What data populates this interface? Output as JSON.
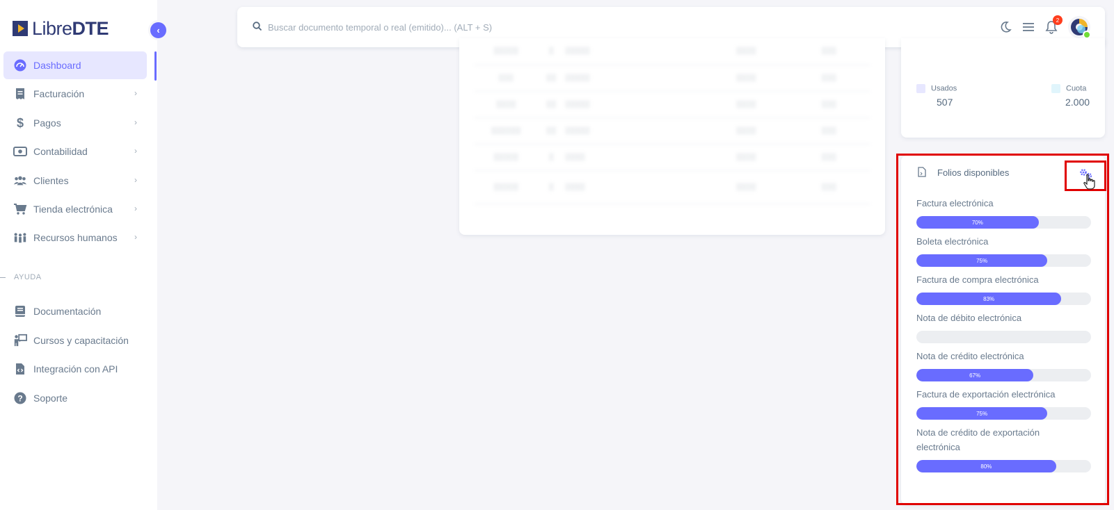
{
  "brand": {
    "prefix": "Libre",
    "suffix": "DTE"
  },
  "sidebar": {
    "items": [
      {
        "label": "Dashboard",
        "icon": "dashboard-icon",
        "active": true,
        "has_children": false
      },
      {
        "label": "Facturación",
        "icon": "invoice-icon",
        "has_children": true
      },
      {
        "label": "Pagos",
        "icon": "dollar-icon",
        "has_children": true
      },
      {
        "label": "Contabilidad",
        "icon": "money-icon",
        "has_children": true
      },
      {
        "label": "Clientes",
        "icon": "users-icon",
        "has_children": true
      },
      {
        "label": "Tienda electrónica",
        "icon": "cart-icon",
        "has_children": true
      },
      {
        "label": "Recursos humanos",
        "icon": "people-icon",
        "has_children": true
      }
    ],
    "help_header": "AYUDA",
    "help_items": [
      {
        "label": "Documentación",
        "icon": "book-icon"
      },
      {
        "label": "Cursos y capacitación",
        "icon": "teacher-icon"
      },
      {
        "label": "Integración con API",
        "icon": "code-file-icon"
      },
      {
        "label": "Soporte",
        "icon": "question-icon"
      }
    ]
  },
  "search": {
    "placeholder": "Buscar documento temporal o real (emitido)... (ALT + S)"
  },
  "topbar": {
    "notification_count": "2"
  },
  "usage": {
    "used_label": "Usados",
    "used_value": "507",
    "quota_label": "Cuota",
    "quota_value": "2.000",
    "used_color": "#e7e7ff",
    "quota_color": "#e0f5fc"
  },
  "folios": {
    "title": "Folios disponibles",
    "items": [
      {
        "label": "Factura electrónica",
        "percent": 70,
        "percent_label": "70%"
      },
      {
        "label": "Boleta electrónica",
        "percent": 75,
        "percent_label": "75%"
      },
      {
        "label": "Factura de compra electrónica",
        "percent": 83,
        "percent_label": "83%"
      },
      {
        "label": "Nota de débito electrónica",
        "percent": 0,
        "percent_label": ""
      },
      {
        "label": "Nota de crédito electrónica",
        "percent": 67,
        "percent_label": "67%"
      },
      {
        "label": "Factura de exportación electrónica",
        "percent": 75,
        "percent_label": "75%"
      },
      {
        "label": "Nota de crédito de exportación electrónica",
        "percent": 80,
        "percent_label": "80%"
      }
    ]
  },
  "colors": {
    "accent": "#696cff",
    "highlight": "#e00000"
  }
}
